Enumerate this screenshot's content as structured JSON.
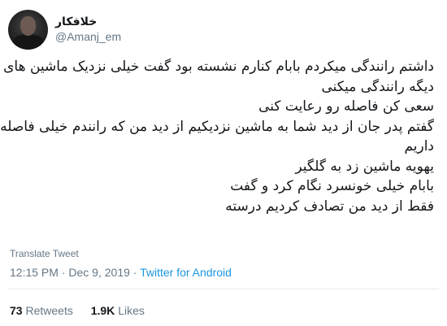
{
  "author": {
    "display_name": "خلافکار",
    "handle": "@Amanj_em"
  },
  "tweet": {
    "lines": [
      "داشتم رانندگی میکردم بابام کنارم نشسته بود گفت خیلی نزدیک ماشین های",
      "دیگه رانندگی میکنی",
      "سعی کن فاصله رو رعایت کنی",
      "گفتم پدر جان از دید شما به ماشین نزدیکیم از دید من که رانندم خیلی فاصله",
      "داریم",
      "یهویه ماشین زد به گلگیر",
      "بابام خیلی خونسرد نگام کرد و گفت",
      "فقط از دید من تصادف کردیم درسته"
    ],
    "translate_label": "Translate Tweet",
    "time": "12:15 PM",
    "separator": "·",
    "date": "Dec 9, 2019",
    "source": "Twitter for Android"
  },
  "stats": {
    "retweets_count": "73",
    "retweets_label": "Retweets",
    "likes_count": "1.9K",
    "likes_label": "Likes"
  }
}
